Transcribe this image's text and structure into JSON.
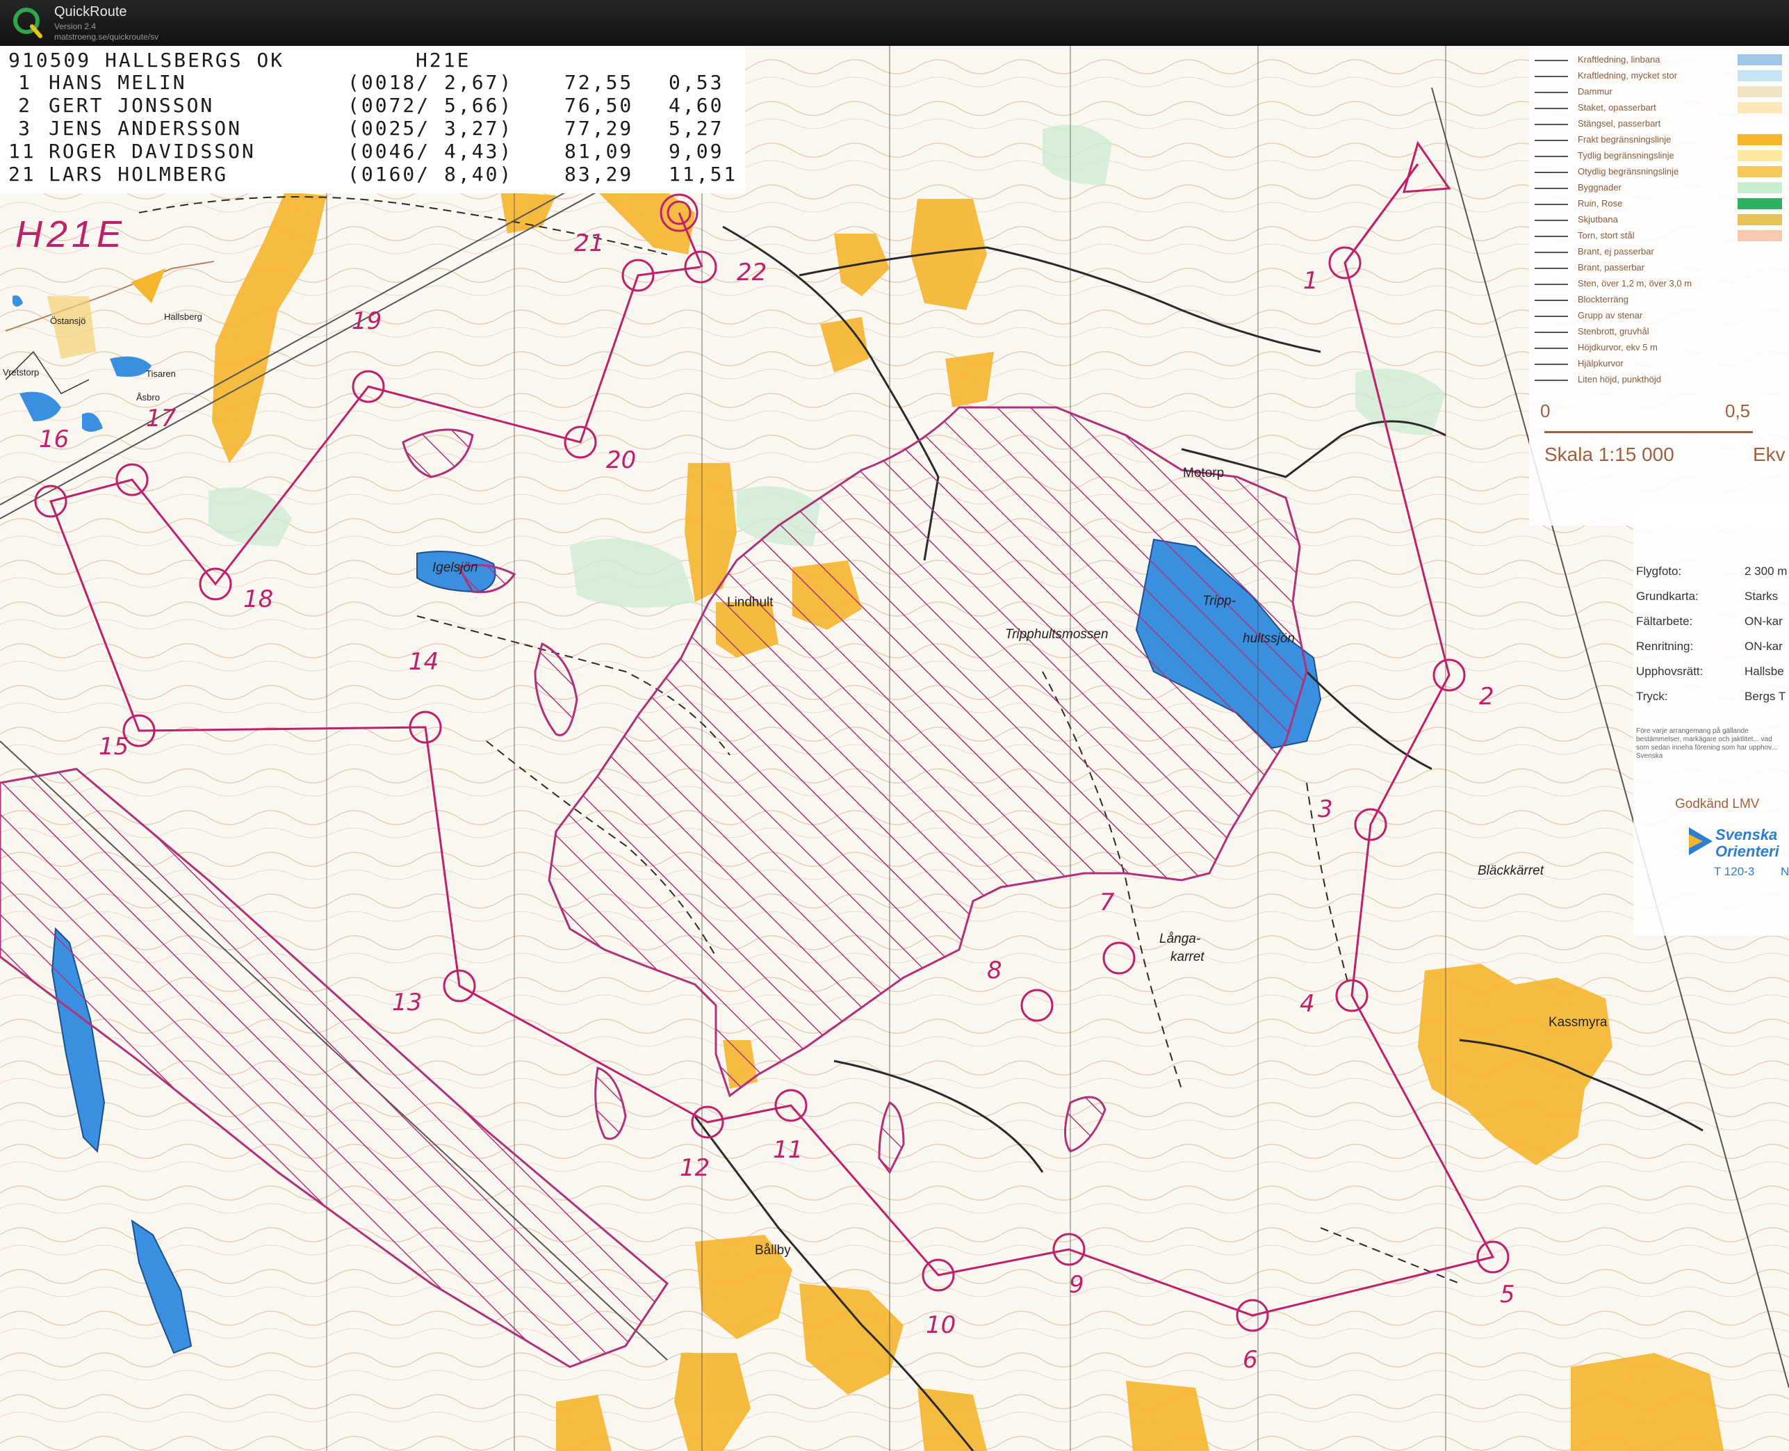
{
  "app": {
    "title": "QuickRoute",
    "version": "Version 2.4",
    "url": "matstroeng.se/quickroute/sv"
  },
  "results": {
    "header": {
      "event": "910509 HALLSBERGS OK",
      "class": "H21E"
    },
    "rows": [
      {
        "place": "1",
        "name": "HANS MELIN",
        "split": "(0018/ 2,67)",
        "time": "72,55",
        "diff": "0,53"
      },
      {
        "place": "2",
        "name": "GERT JONSSON",
        "split": "(0072/ 5,66)",
        "time": "76,50",
        "diff": "4,60"
      },
      {
        "place": "3",
        "name": "JENS ANDERSSON",
        "split": "(0025/ 3,27)",
        "time": "77,29",
        "diff": "5,27"
      },
      {
        "place": "11",
        "name": "ROGER DAVIDSSON",
        "split": "(0046/ 4,43)",
        "time": "81,09",
        "diff": "9,09"
      },
      {
        "place": "21",
        "name": "LARS HOLMBERG",
        "split": "(0160/ 8,40)",
        "time": "83,29",
        "diff": "11,51"
      }
    ]
  },
  "class_label": "H21E",
  "inset_places": [
    "Östansjö",
    "Hallsberg",
    "Vretstorp",
    "Tisaren",
    "Åsbro"
  ],
  "legend": {
    "items": [
      "Kraftledning, linbana",
      "Kraftledning, mycket stor",
      "Dammur",
      "Staket, opasserbart",
      "Stängsel, passerbart",
      "Frakt begränsningslinje",
      "Tydlig begränsningslinje",
      "Otydlig begränsningslinje",
      "Byggnader",
      "Ruin, Rose",
      "Skjutbana",
      "Torn, stort stål",
      "Brant, ej passerbar",
      "Brant, passerbar",
      "Sten, över 1,2 m, över 3,0 m",
      "Blockterräng",
      "Grupp av stenar",
      "Stenbrott, gruvhål",
      "Höjdkurvor, ekv 5 m",
      "Hjälpkurvor",
      "Liten höjd, punkthöjd"
    ],
    "scale_zero": "0",
    "scale_half": "0,5",
    "scale_title": "Skala 1:15 000",
    "scale_ekv": "Ekv"
  },
  "map_info": {
    "rows": [
      {
        "label": "Flygfoto:",
        "value": "2 300 m"
      },
      {
        "label": "Grundkarta:",
        "value": "Starks"
      },
      {
        "label": "Fältarbete:",
        "value": "ON-kar"
      },
      {
        "label": "Renritning:",
        "value": "ON-kar"
      },
      {
        "label": "Upphovsrätt:",
        "value": "Hallsbe"
      },
      {
        "label": "Tryck:",
        "value": "Bergs T"
      }
    ],
    "note": "Före varje arrangemang på gällande bestämmelser, markägare och jaktlitet... vad som sedan inneha förening som har upphov... Svenska",
    "approved": "Godkänd LMV",
    "federation_line1": "Svenska",
    "federation_line2": "Orienteri",
    "code": "T 120-3",
    "code_suffix": "N"
  },
  "places": [
    {
      "name": "Igelsjön",
      "italic": true
    },
    {
      "name": "Lindhult",
      "italic": false
    },
    {
      "name": "Motorp",
      "italic": false
    },
    {
      "name": "Tripphultsmossen",
      "italic": true
    },
    {
      "name": "Tripp-",
      "italic": true
    },
    {
      "name": "hultssjön",
      "italic": true
    },
    {
      "name": "Långa-",
      "italic": true
    },
    {
      "name": "karret",
      "italic": true
    },
    {
      "name": "Bläckkärret",
      "italic": true
    },
    {
      "name": "Kassmyra",
      "italic": false
    },
    {
      "name": "Bållby",
      "italic": false
    }
  ],
  "control_numbers": [
    "1",
    "2",
    "3",
    "4",
    "5",
    "6",
    "7",
    "8",
    "9",
    "10",
    "11",
    "12",
    "13",
    "14",
    "15",
    "16",
    "17",
    "18",
    "19",
    "20",
    "21",
    "22"
  ],
  "colors": {
    "course": "#c0206a",
    "open_land": "#f5b52e",
    "water": "#3a8fe0",
    "green": "#c8ecd0",
    "contour": "#c8885a"
  }
}
